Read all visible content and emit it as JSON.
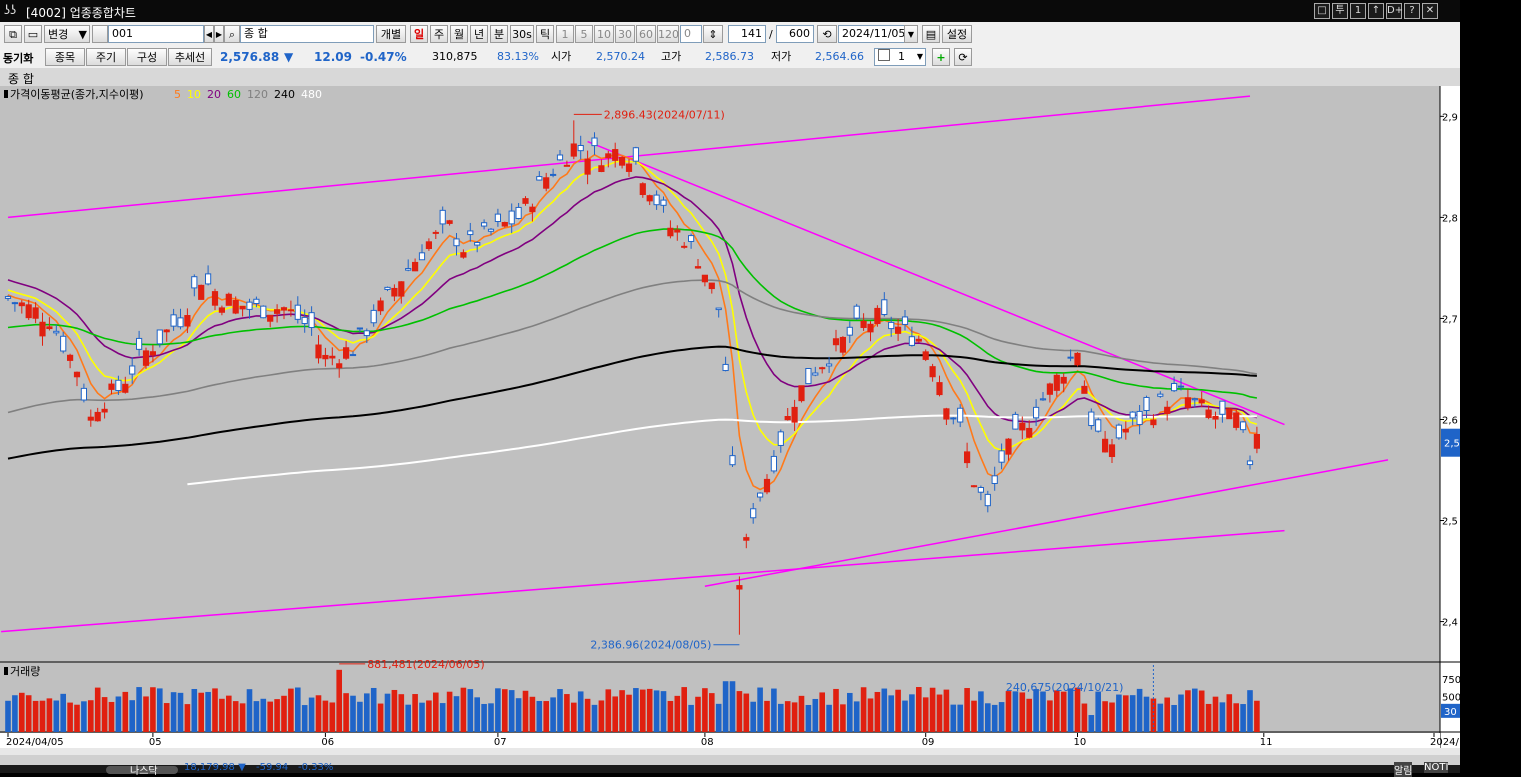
{
  "window": {
    "logo": "ʖʖ",
    "title": "[4002] 업종종합차트"
  },
  "window_buttons": [
    "□",
    "투",
    "1",
    "↑",
    "D+",
    "?",
    "✕"
  ],
  "toolbar": {
    "change_label": "변경",
    "code_value": "001",
    "name_value": "종          합",
    "individual_label": "개별",
    "periods": [
      "일",
      "주",
      "월",
      "년",
      "분",
      "30s",
      "틱"
    ],
    "active_period": "일",
    "minute_options": [
      "1",
      "5",
      "10",
      "30",
      "60",
      "120"
    ],
    "minute_custom": "0",
    "count_value": "141",
    "count_sep": "/",
    "count_total": "600",
    "date_value": "2024/11/05",
    "settings_label": "설정"
  },
  "quote": {
    "name": "동기화",
    "tab_items": "종목",
    "tab_period": "주기",
    "tab_config": "구성",
    "tab_trend": "추세선",
    "price": "2,576.88",
    "direction": "▼",
    "change": "12.09",
    "change_pct": "-0.47%",
    "volume": "310,875",
    "ratio": "83.13%",
    "open_label": "시가",
    "open": "2,570.24",
    "high_label": "고가",
    "high": "2,586.73",
    "low_label": "저가",
    "low": "2,564.66",
    "mult": "1"
  },
  "name_bar": "종        합",
  "legend": {
    "title": "가격이동평균(종가,지수이평)",
    "items": [
      {
        "label": "5",
        "color": "#ff7a1a"
      },
      {
        "label": "10",
        "color": "#ffff00"
      },
      {
        "label": "20",
        "color": "#800080"
      },
      {
        "label": "60",
        "color": "#00c000"
      },
      {
        "label": "120",
        "color": "#808080"
      },
      {
        "label": "240",
        "color": "#000000"
      },
      {
        "label": "480",
        "color": "#ffffff"
      }
    ]
  },
  "annotations": {
    "high": "2,896.43(2024/07/11)",
    "low": "2,386.96(2024/08/05)",
    "vol_high": "881,481(2024/06/05)",
    "vol_mark": "240,675(2024/10/21)"
  },
  "volume_panel_title": "거래량",
  "colors": {
    "up": "#e02010",
    "down": "#1f64c8",
    "trendline": "#ff00ff",
    "chart_bg": "#c0c0c0"
  },
  "chart_data": {
    "type": "candlestick",
    "y_ticks": [
      "2,9",
      "2,8",
      "2,7",
      "2,6",
      "2,5",
      "2,4"
    ],
    "y_tick_values": [
      2900,
      2800,
      2700,
      2600,
      2500,
      2400
    ],
    "ylim": [
      2360,
      2930
    ],
    "vol_ticks": [
      "750",
      "500"
    ],
    "vol_tick_values": [
      750000,
      500000
    ],
    "vol_lim": [
      0,
      950000
    ],
    "x_labels": [
      "2024/04/05",
      "05",
      "06",
      "07",
      "08",
      "09",
      "10",
      "11",
      "2024/"
    ],
    "x_label_index": [
      0,
      21,
      46,
      71,
      101,
      133,
      155,
      182,
      213
    ],
    "last_price_marker": "2,5",
    "vol_marker": "30",
    "candles_count": 182
  },
  "footer": {
    "nasdaq_label": "나스닥",
    "nasdaq_value": "18,179.98 ▼",
    "nasdaq_change": "-59.94",
    "nasdaq_pct": "-0.33%",
    "right_a": "알림",
    "right_b": "NOTI"
  }
}
